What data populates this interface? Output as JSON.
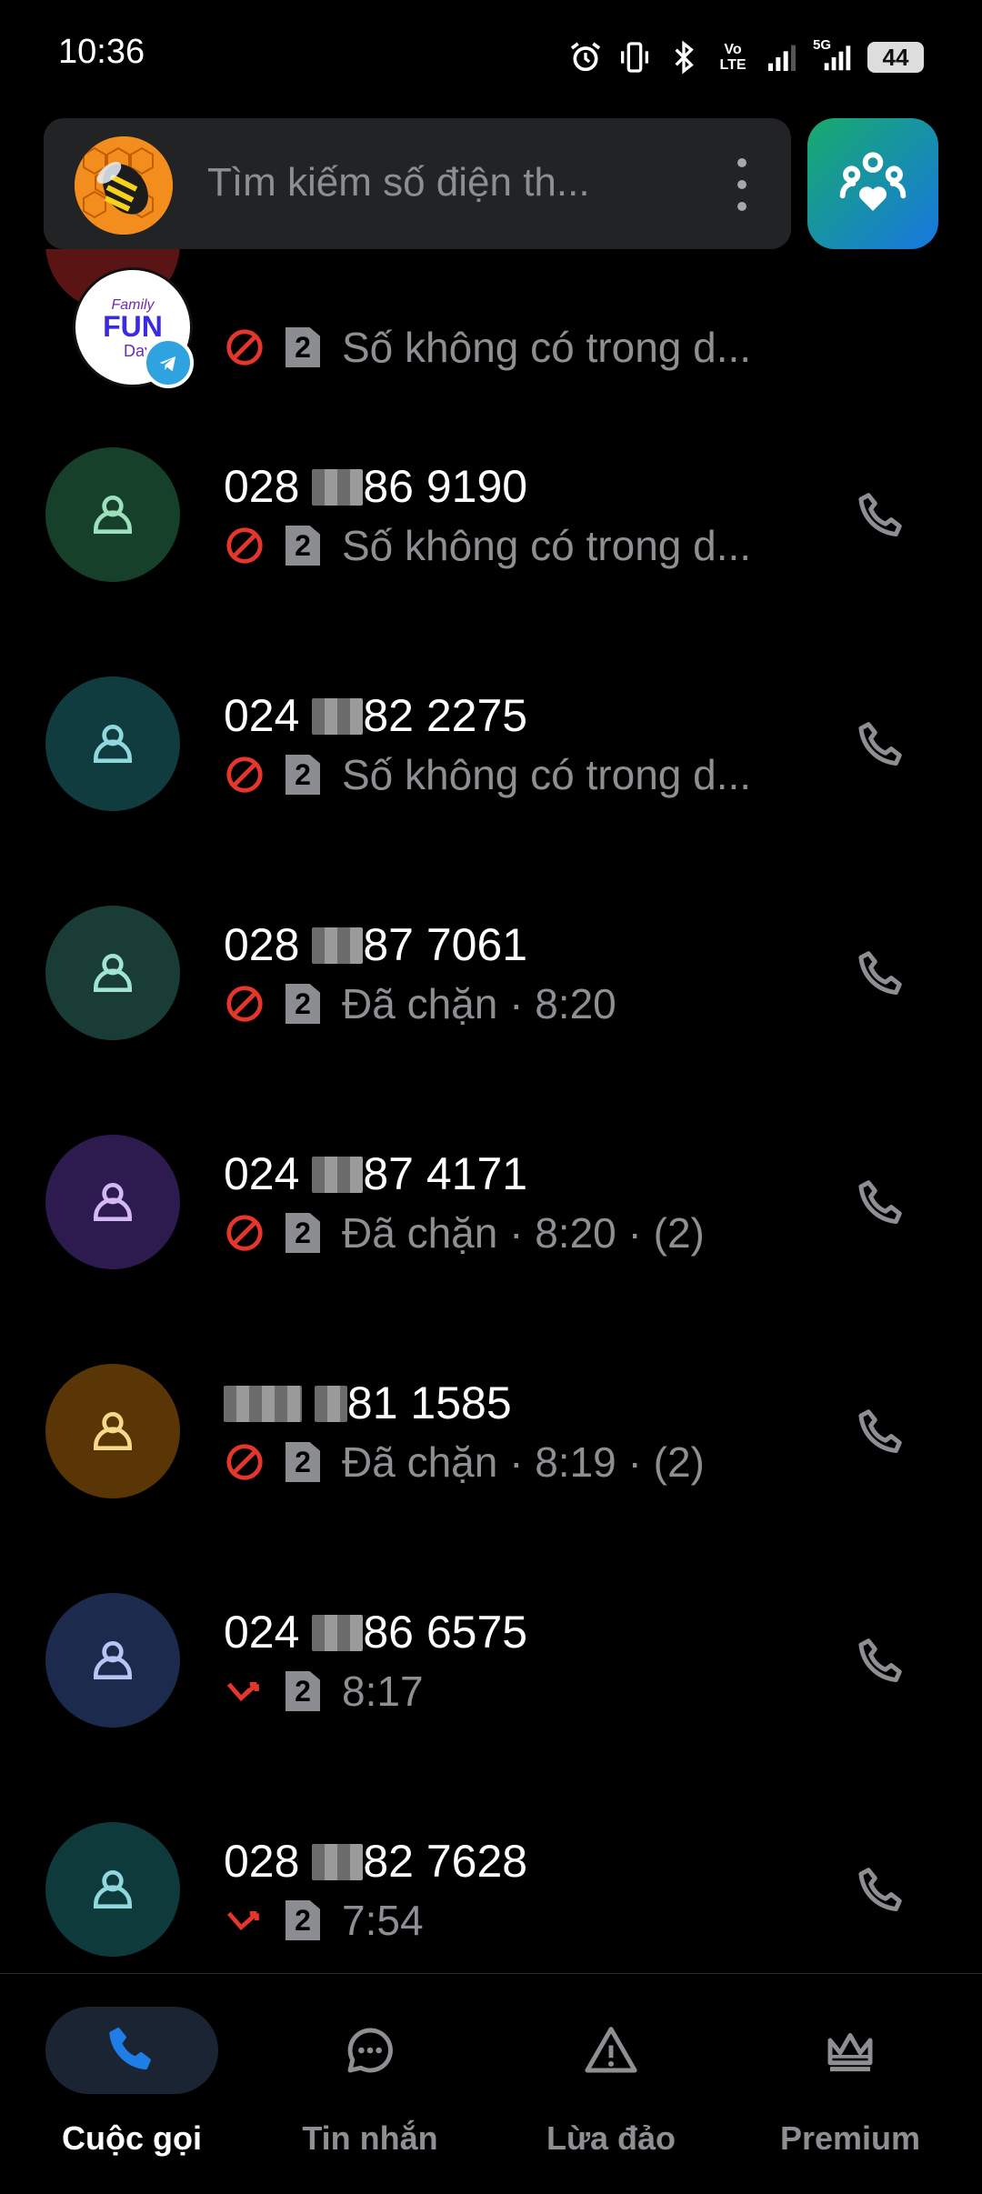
{
  "status_bar": {
    "time": "10:36",
    "icons": [
      "alarm-icon",
      "vibrate-icon",
      "bluetooth-icon",
      "volte-icon",
      "signal-icon",
      "5g-signal-icon",
      "battery-icon"
    ],
    "volte_text": "Vo LTE",
    "sim_net": "5G",
    "battery": "44"
  },
  "search": {
    "placeholder": "Tìm kiếm số điện th..."
  },
  "colors": {
    "accent_blue": "#1e7de6",
    "blocked_red": "#e5362c",
    "text_secondary": "#8e8f92"
  },
  "calls": [
    {
      "number": "",
      "status_icon": "blocked",
      "sim": "2",
      "detail": "Số không có trong d...",
      "avatar_color": "#5a1414"
    },
    {
      "number_prefix": "028",
      "number_suffix": "86 9190",
      "status_icon": "blocked",
      "sim": "2",
      "detail": "Số không có trong d...",
      "avatar_color": "#16402a"
    },
    {
      "number_prefix": "024",
      "number_suffix": "82 2275",
      "status_icon": "blocked",
      "sim": "2",
      "detail": "Số không có trong d...",
      "avatar_color": "#103c40"
    },
    {
      "number_prefix": "028",
      "number_suffix": "87 7061",
      "status_icon": "blocked",
      "sim": "2",
      "detail": "Đã chặn · 8:20",
      "avatar_color": "#1a3c36"
    },
    {
      "number_prefix": "024",
      "number_suffix": "87 4171",
      "status_icon": "blocked",
      "sim": "2",
      "detail": "Đã chặn · 8:20 · (2)",
      "avatar_color": "#2d1a4e"
    },
    {
      "number_prefix": "",
      "number_suffix": "81 1585",
      "status_icon": "blocked",
      "sim": "2",
      "detail": "Đã chặn · 8:19 · (2)",
      "avatar_color": "#5a3606"
    },
    {
      "number_prefix": "024",
      "number_suffix": "86 6575",
      "status_icon": "missed",
      "sim": "2",
      "detail": "8:17",
      "avatar_color": "#1c2a4e"
    },
    {
      "number_prefix": "028",
      "number_suffix": "82 7628",
      "status_icon": "missed",
      "sim": "2",
      "detail": "7:54",
      "avatar_color": "#0e3a3c"
    }
  ],
  "nav": {
    "calls": "Cuộc gọi",
    "messages": "Tin nhắn",
    "scam": "Lừa đảo",
    "premium": "Premium"
  }
}
